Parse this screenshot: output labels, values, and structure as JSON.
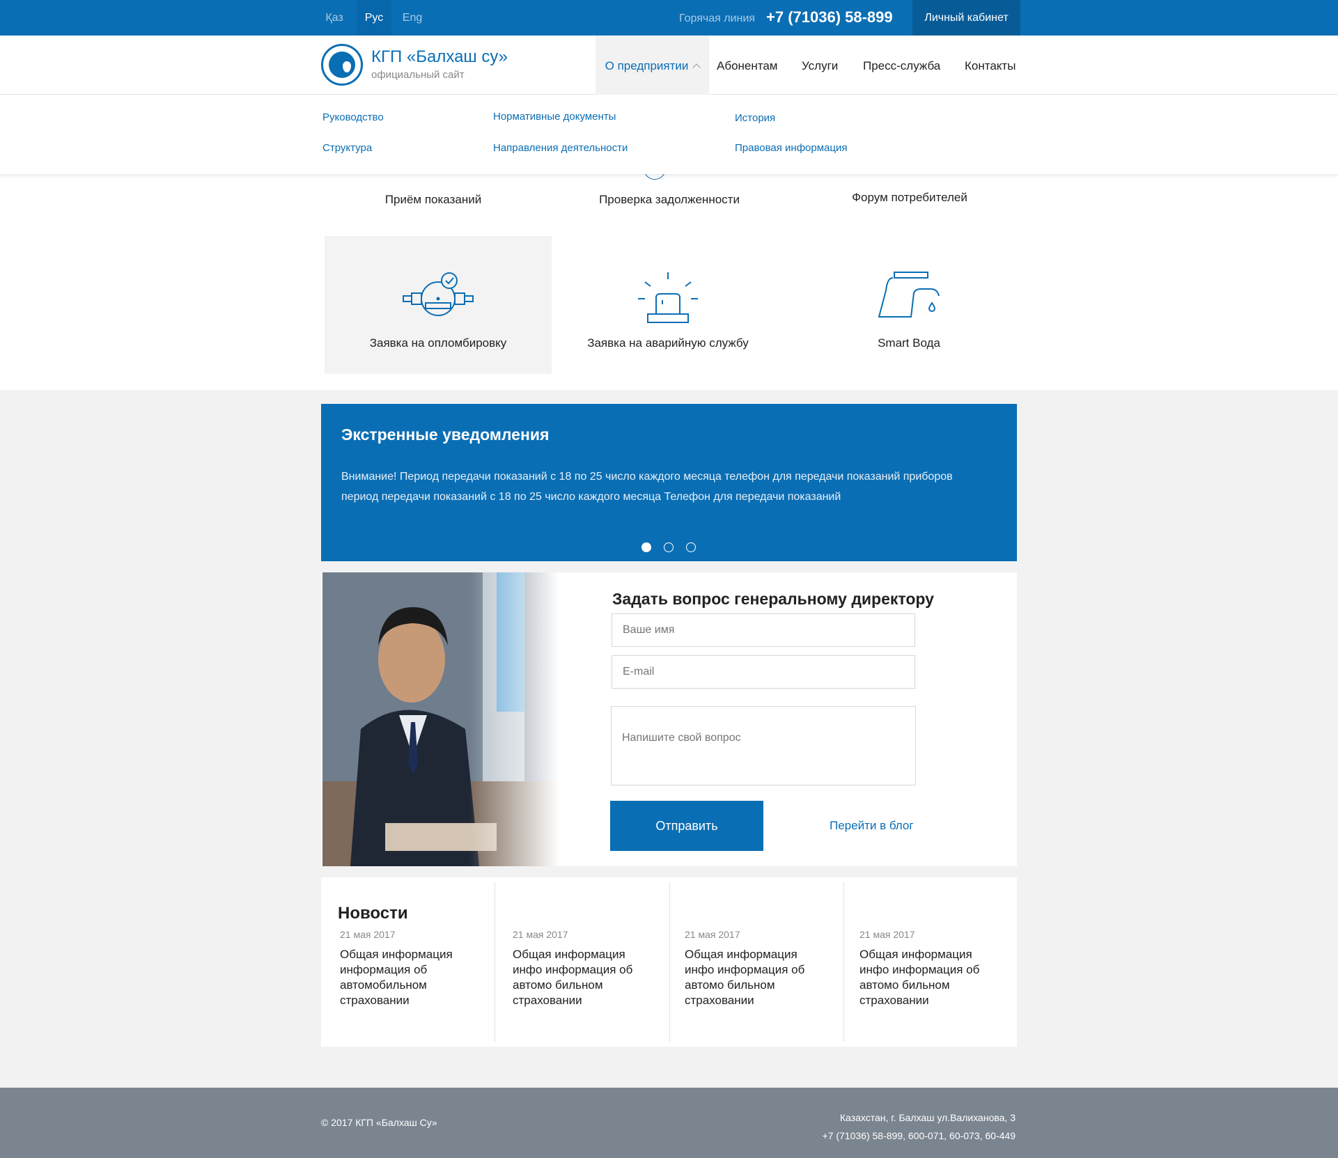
{
  "topbar": {
    "languages": [
      {
        "label": "Қаз",
        "active": false
      },
      {
        "label": "Рус",
        "active": true
      },
      {
        "label": "Eng",
        "active": false
      }
    ],
    "hotline_label": "Горячая линия",
    "hotline_phone": "+7 (71036) 58-899",
    "cabinet_label": "Личный кабинет"
  },
  "header": {
    "site_name": "КГП «Балхаш су»",
    "site_sub": "официальный сайт",
    "nav": [
      {
        "label": "О предприятии",
        "active": true
      },
      {
        "label": "Абонентам"
      },
      {
        "label": "Услуги"
      },
      {
        "label": "Пресс-служба"
      },
      {
        "label": "Контакты"
      }
    ]
  },
  "dropdown": {
    "links": [
      "Руководство",
      "Нормативные документы",
      "История",
      "Структура",
      "Направления деятельности",
      "Правовая информация"
    ]
  },
  "services": {
    "row1": [
      "Приём показаний",
      "Проверка задолженности",
      "Форум потребителей"
    ],
    "row2": [
      {
        "label": "Заявка на опломбировку",
        "icon": "water-meter-icon",
        "highlighted": true
      },
      {
        "label": "Заявка на аварийную службу",
        "icon": "siren-icon"
      },
      {
        "label": "Smart Вода",
        "icon": "faucet-icon"
      }
    ]
  },
  "emergency": {
    "title": "Экстренные уведомления",
    "text": "Внимание! Период передачи показаний с 18 по 25 число каждого месяца телефон для передачи показаний приборов период передачи показаний с 18 по 25 число каждого месяца Телефон для передачи показаний",
    "slides": 3,
    "active_slide": 1
  },
  "director": {
    "title": "Задать вопрос генеральному директору",
    "name_placeholder": "Ваше имя",
    "email_placeholder": "E-mail",
    "question_placeholder": "Напишите свой вопрос",
    "send_label": "Отправить",
    "blog_label": "Перейти в блог"
  },
  "news": {
    "title": "Новости",
    "items": [
      {
        "date": "21 мая 2017",
        "text": "Общая информация информация об автомобильном страховании"
      },
      {
        "date": "21 мая 2017",
        "text": "Общая информация инфо информация об автомо бильном  страховании"
      },
      {
        "date": "21 мая 2017",
        "text": "Общая информация инфо информация об автомо бильном  страховании"
      },
      {
        "date": "21 мая 2017",
        "text": "Общая информация инфо информация об автомо бильном  страховании"
      }
    ]
  },
  "footer": {
    "copyright": "© 2017 КГП «Балхаш Су»",
    "address": "Казахстан, г. Балхаш ул.Валиханова, 3",
    "phones": "+7 (71036) 58-899, 600-071, 60-073, 60-449"
  },
  "colors": {
    "brand": "#0a6eb4",
    "footer": "#7b8590",
    "background": "#f2f2f2"
  }
}
